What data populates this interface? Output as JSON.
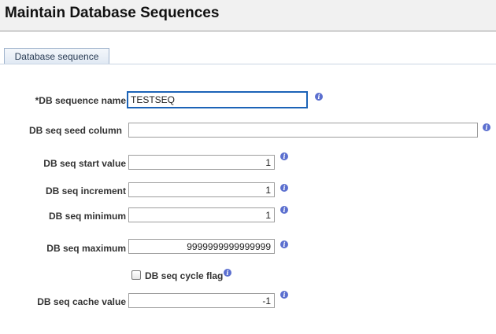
{
  "page_title": "Maintain Database Sequences",
  "tabs": [
    {
      "label": "Database sequence",
      "active": true
    }
  ],
  "info_glyph": "i",
  "fields": {
    "sequence_name": {
      "label": "*DB sequence name",
      "value": "TESTSEQ"
    },
    "seed_column": {
      "label": "DB seq seed column",
      "value": ""
    },
    "start_value": {
      "label": "DB seq start value",
      "value": "1"
    },
    "increment": {
      "label": "DB seq increment",
      "value": "1"
    },
    "minimum": {
      "label": "DB seq minimum",
      "value": "1"
    },
    "maximum": {
      "label": "DB seq maximum",
      "value": "9999999999999999"
    },
    "cycle_flag": {
      "label": "DB seq cycle flag",
      "checked": false
    },
    "cache_value": {
      "label": "DB seq cache value",
      "value": "-1"
    }
  },
  "colors": {
    "focus_border": "#1c63b7",
    "info_icon": "#5b6fcf",
    "tab_border": "#9fb3cc"
  }
}
